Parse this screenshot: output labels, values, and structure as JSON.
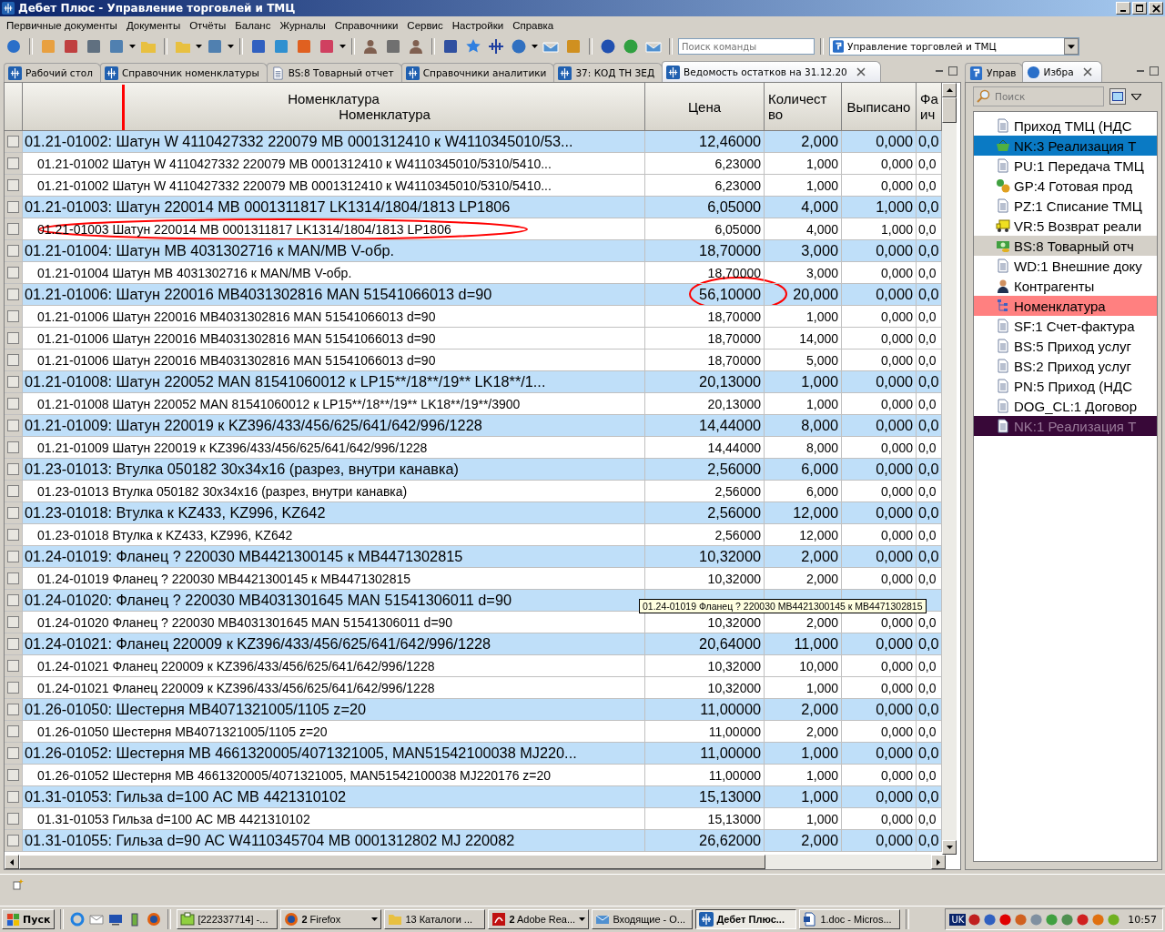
{
  "window": {
    "title": "Дебет Плюс - Управление торговлей и ТМЦ"
  },
  "menu": [
    "Первичные документы",
    "Документы",
    "Отчёты",
    "Баланс",
    "Журналы",
    "Справочники",
    "Сервис",
    "Настройки",
    "Справка"
  ],
  "toolbar": {
    "command_search": {
      "placeholder": "Поиск команды"
    },
    "module": "Управление торговлей и ТМЦ"
  },
  "tabs": [
    {
      "label": "Рабочий стол",
      "kind": "logo",
      "selected": false
    },
    {
      "label": "Справочник номенклатуры",
      "kind": "logo",
      "selected": false
    },
    {
      "label": "BS:8 Товарный отчет",
      "kind": "doc",
      "selected": false
    },
    {
      "label": "Справочники аналитики",
      "kind": "logo",
      "selected": false
    },
    {
      "label": "37: КОД ТН ЗЕД",
      "kind": "logo",
      "selected": false
    },
    {
      "label": "Ведомость остатков на 31.12.20",
      "kind": "logo",
      "selected": true
    }
  ],
  "table": {
    "columns": [
      {
        "lines": [
          "Номенклатура",
          "Номенклатура"
        ],
        "marked": true
      },
      {
        "lines": [
          "Цена"
        ],
        "marked": false
      },
      {
        "lines": [
          "Количест",
          "во"
        ],
        "marked": false
      },
      {
        "lines": [
          "Выписано"
        ],
        "marked": false
      },
      {
        "lines": [
          "Фа",
          "ич"
        ],
        "marked": false
      }
    ],
    "rows": [
      {
        "kind": "group",
        "checked": false,
        "name": "01.21-01002: Шатун W 4110427332 220079 МВ 0001312410 к W4110345010/53...",
        "price": "12,46000",
        "qty": "2,000",
        "issued": "0,000",
        "column_5": "0,0"
      },
      {
        "kind": "item",
        "checked": false,
        "name": "01.21-01002 Шатун W 4110427332 220079 МВ 0001312410 к W4110345010/5310/5410...",
        "price": "6,23000",
        "qty": "1,000",
        "issued": "0,000",
        "column_5": "0,0"
      },
      {
        "kind": "item",
        "checked": false,
        "name": "01.21-01002 Шатун W 4110427332 220079 МВ 0001312410 к W4110345010/5310/5410...",
        "price": "6,23000",
        "qty": "1,000",
        "issued": "0,000",
        "column_5": "0,0"
      },
      {
        "kind": "group",
        "checked": false,
        "name": "01.21-01003: Шатун 220014 МВ 0001311817 LK1314/1804/1813 LP1806",
        "price": "6,05000",
        "qty": "4,000",
        "issued": "1,000",
        "column_5": "0,0"
      },
      {
        "kind": "item",
        "checked": false,
        "name_circled": true,
        "name": "01.21-01003 Шатун 220014 МВ 0001311817 LK1314/1804/1813 LP1806",
        "price": "6,05000",
        "qty": "4,000",
        "issued": "1,000",
        "column_5": "0,0"
      },
      {
        "kind": "group",
        "checked": false,
        "name": "01.21-01004: Шатун МВ 4031302716 к MAN/МВ V-обр.",
        "price": "18,70000",
        "qty": "3,000",
        "issued": "0,000",
        "column_5": "0,0"
      },
      {
        "kind": "item",
        "checked": false,
        "name": "01.21-01004 Шатун МВ 4031302716 к MAN/МВ V-обр.",
        "price": "18,70000",
        "qty": "3,000",
        "issued": "0,000",
        "column_5": "0,0"
      },
      {
        "kind": "group",
        "checked": false,
        "price_circled": true,
        "name": "01.21-01006: Шатун 220016 МВ4031302816 MAN 51541066013 d=90",
        "price": "56,10000",
        "qty": "20,000",
        "issued": "0,000",
        "column_5": "0,0"
      },
      {
        "kind": "item",
        "checked": false,
        "name": "01.21-01006 Шатун 220016 МВ4031302816 MAN 51541066013 d=90",
        "price": "18,70000",
        "qty": "1,000",
        "issued": "0,000",
        "column_5": "0,0"
      },
      {
        "kind": "item",
        "checked": false,
        "name": "01.21-01006 Шатун 220016 МВ4031302816 MAN 51541066013 d=90",
        "price": "18,70000",
        "qty": "14,000",
        "issued": "0,000",
        "column_5": "0,0"
      },
      {
        "kind": "item",
        "checked": false,
        "name": "01.21-01006 Шатун 220016 МВ4031302816 MAN 51541066013 d=90",
        "price": "18,70000",
        "qty": "5,000",
        "issued": "0,000",
        "column_5": "0,0"
      },
      {
        "kind": "group",
        "checked": false,
        "name": "01.21-01008: Шатун 220052 MAN 81541060012 к LP15**/18**/19** LK18**/1...",
        "price": "20,13000",
        "qty": "1,000",
        "issued": "0,000",
        "column_5": "0,0"
      },
      {
        "kind": "item",
        "checked": false,
        "name": "01.21-01008 Шатун 220052 MAN 81541060012 к LP15**/18**/19** LK18**/19**/3900",
        "price": "20,13000",
        "qty": "1,000",
        "issued": "0,000",
        "column_5": "0,0"
      },
      {
        "kind": "group",
        "checked": false,
        "name": "01.21-01009: Шатун 220019 к KZ396/433/456/625/641/642/996/1228",
        "price": "14,44000",
        "qty": "8,000",
        "issued": "0,000",
        "column_5": "0,0"
      },
      {
        "kind": "item",
        "checked": false,
        "name": "01.21-01009 Шатун 220019 к KZ396/433/456/625/641/642/996/1228",
        "price": "14,44000",
        "qty": "8,000",
        "issued": "0,000",
        "column_5": "0,0"
      },
      {
        "kind": "group",
        "checked": false,
        "name": "01.23-01013: Втулка 050182 30x34x16 (разрез, внутри канавка)",
        "price": "2,56000",
        "qty": "6,000",
        "issued": "0,000",
        "column_5": "0,0"
      },
      {
        "kind": "item",
        "checked": false,
        "name": "01.23-01013 Втулка 050182 30x34x16 (разрез, внутри канавка)",
        "price": "2,56000",
        "qty": "6,000",
        "issued": "0,000",
        "column_5": "0,0"
      },
      {
        "kind": "group",
        "checked": false,
        "name": "01.23-01018: Втулка к KZ433, KZ996, KZ642",
        "price": "2,56000",
        "qty": "12,000",
        "issued": "0,000",
        "column_5": "0,0"
      },
      {
        "kind": "item",
        "checked": false,
        "name": "01.23-01018 Втулка к KZ433, KZ996, KZ642",
        "price": "2,56000",
        "qty": "12,000",
        "issued": "0,000",
        "column_5": "0,0"
      },
      {
        "kind": "group",
        "checked": false,
        "name": "01.24-01019: Фланец ? 220030 МВ4421300145 к МВ4471302815",
        "price": "10,32000",
        "qty": "2,000",
        "issued": "0,000",
        "column_5": "0,0"
      },
      {
        "kind": "item",
        "checked": false,
        "name": "01.24-01019 Фланец ? 220030 МВ4421300145 к МВ4471302815",
        "price": "10,32000",
        "qty": "2,000",
        "issued": "0,000",
        "column_5": "0,0"
      },
      {
        "kind": "group",
        "checked": false,
        "name": "01.24-01020: Фланец ? 220030 МВ4031301645 MAN  51541306011 d=90",
        "tooltip": "01.24-01019 Фланец ? 220030 МВ4421300145 к МВ4471302815"
      },
      {
        "kind": "item",
        "checked": false,
        "name": "01.24-01020 Фланец ? 220030 МВ4031301645 MAN  51541306011 d=90",
        "price": "10,32000",
        "qty": "2,000",
        "issued": "0,000",
        "column_5": "0,0"
      },
      {
        "kind": "group",
        "checked": false,
        "name": "01.24-01021: Фланец 220009 к KZ396/433/456/625/641/642/996/1228",
        "price": "20,64000",
        "qty": "11,000",
        "issued": "0,000",
        "column_5": "0,0"
      },
      {
        "kind": "item",
        "checked": false,
        "name": "01.24-01021 Фланец 220009 к KZ396/433/456/625/641/642/996/1228",
        "price": "10,32000",
        "qty": "10,000",
        "issued": "0,000",
        "column_5": "0,0"
      },
      {
        "kind": "item",
        "checked": false,
        "name": "01.24-01021 Фланец 220009 к KZ396/433/456/625/641/642/996/1228",
        "price": "10,32000",
        "qty": "1,000",
        "issued": "0,000",
        "column_5": "0,0"
      },
      {
        "kind": "group",
        "checked": false,
        "name": "01.26-01050: Шестерня МВ4071321005/1105 z=20",
        "price": "11,00000",
        "qty": "2,000",
        "issued": "0,000",
        "column_5": "0,0"
      },
      {
        "kind": "item",
        "checked": false,
        "name": "01.26-01050 Шестерня МВ4071321005/1105 z=20",
        "price": "11,00000",
        "qty": "2,000",
        "issued": "0,000",
        "column_5": "0,0"
      },
      {
        "kind": "group",
        "checked": false,
        "name": "01.26-01052: Шестерня МВ 4661320005/4071321005, MAN51542100038 MJ220...",
        "price": "11,00000",
        "qty": "1,000",
        "issued": "0,000",
        "column_5": "0,0"
      },
      {
        "kind": "item",
        "checked": false,
        "name": "01.26-01052 Шестерня МВ 4661320005/4071321005, MAN51542100038 MJ220176 z=20",
        "price": "11,00000",
        "qty": "1,000",
        "issued": "0,000",
        "column_5": "0,0"
      },
      {
        "kind": "group",
        "checked": false,
        "name": "01.31-01053: Гильза d=100 АС МВ 4421310102",
        "price": "15,13000",
        "qty": "1,000",
        "issued": "0,000",
        "column_5": "0,0"
      },
      {
        "kind": "item",
        "checked": false,
        "name": "01.31-01053 Гильза d=100 АС МВ 4421310102",
        "price": "15,13000",
        "qty": "1,000",
        "issued": "0,000",
        "column_5": "0,0"
      },
      {
        "kind": "group",
        "checked": false,
        "name": "01.31-01055: Гильза d=90 АС W4110345704 МВ 0001312802 MJ 220082",
        "price": "26,62000",
        "qty": "2,000",
        "issued": "0,000",
        "column_5": "0,0"
      }
    ]
  },
  "side_tabs": [
    {
      "label": "Управ",
      "kind": "logo",
      "selected": false
    },
    {
      "label": "Избра",
      "kind": "db",
      "selected": true
    }
  ],
  "side_search": {
    "placeholder": "Поиск"
  },
  "favorites": [
    {
      "label": "Приход ТМЦ (НДС",
      "kind": "doc"
    },
    {
      "label": "NK:3 Реализация Т",
      "kind": "basket",
      "color": "#0a7ac4"
    },
    {
      "label": "PU:1 Передача ТМЦ",
      "kind": "doc"
    },
    {
      "label": "GP:4 Готовая прод",
      "kind": "gears"
    },
    {
      "label": "PZ:1 Списание ТМЦ",
      "kind": "doc"
    },
    {
      "label": "VR:5 Возврат реали",
      "kind": "truck"
    },
    {
      "label": "BS:8 Товарный отч",
      "kind": "money",
      "color": "#d4d0c8"
    },
    {
      "label": "WD:1 Внешние доку",
      "kind": "doc"
    },
    {
      "label": "Контрагенты",
      "kind": "person"
    },
    {
      "label": "Номенклатура",
      "kind": "tree",
      "color": "#ff8080"
    },
    {
      "label": "SF:1 Счет-фактура",
      "kind": "doc"
    },
    {
      "label": "BS:5 Приход услуг",
      "kind": "doc"
    },
    {
      "label": "BS:2 Приход услуг",
      "kind": "doc"
    },
    {
      "label": "PN:5 Приход   (НДС",
      "kind": "doc"
    },
    {
      "label": "DOG_CL:1 Договор",
      "kind": "doc"
    },
    {
      "label": "NK:1 Реализация Т",
      "kind": "doc",
      "color": "#380838"
    }
  ],
  "taskbar": {
    "start": "Пуск",
    "tasks": [
      {
        "label": "[222337714] -...",
        "kind": "app",
        "selected": false,
        "menu": false
      },
      {
        "label": "**2** Firefox",
        "kind": "firefox",
        "selected": false,
        "menu": true
      },
      {
        "label": "13 Каталоги ...",
        "kind": "folder",
        "selected": false,
        "menu": false
      },
      {
        "label": "**2** Adobe Rea...",
        "kind": "pdf",
        "selected": false,
        "menu": true
      },
      {
        "label": "Входящие - О...",
        "kind": "mail",
        "selected": false,
        "menu": false
      },
      {
        "label": "Дебет Плюс...",
        "kind": "logo",
        "selected": true,
        "menu": false
      },
      {
        "label": "1.doc - Micros...",
        "kind": "word",
        "selected": false,
        "menu": false
      }
    ],
    "language": "UK",
    "clock": "10:57"
  }
}
